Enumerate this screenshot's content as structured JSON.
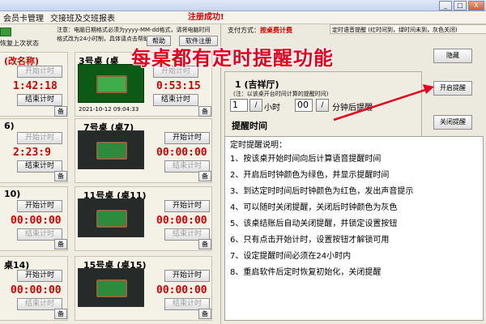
{
  "menu": {
    "items": [
      "会员卡管理",
      "交接班及交班报表"
    ],
    "register_status": "注册成功!"
  },
  "window": {
    "buttons": [
      "_",
      "□",
      "X"
    ]
  },
  "toolbar": {
    "restore_label": "恢复上次状态",
    "notice_line1": "注意：电脑日期格式必须为yyyy-MM-dd格式，请将电脑时间",
    "notice_line2": "格式改为24小时制，具体请点击帮助",
    "help_label": "帮助",
    "soft_reg_label": "软件注册"
  },
  "headline": "每桌都有定时提醒功能",
  "tables": [
    {
      "name": "(改名称)",
      "start": "开始计时",
      "time": "1:42:18",
      "end": "结束计时",
      "date": "",
      "bei": "备"
    },
    {
      "name": "3号桌 (桌",
      "start": "开始计时",
      "time": "0:53:15",
      "end": "结束计时",
      "date": "2021-10-12 09:04:33",
      "bei": "备"
    },
    {
      "name": "6)",
      "start": "开始计时",
      "time": "2:23:9",
      "end": "结束计时",
      "date": "",
      "bei": "备"
    },
    {
      "name": "7号桌 (桌7)",
      "start": "开始计时",
      "time": "00:00:00",
      "end": "结束计时",
      "date": "",
      "bei": "备"
    },
    {
      "name": "10)",
      "start": "开始计时",
      "time": "00:00:00",
      "end": "结束计时",
      "date": "",
      "bei": "备"
    },
    {
      "name": "11号桌 (桌11)",
      "start": "开始计时",
      "time": "00:00:00",
      "end": "结束计时",
      "date": "",
      "bei": "备"
    },
    {
      "name": "桌14)",
      "start": "开始计时",
      "time": "00:00:00",
      "end": "结束计时",
      "date": "",
      "bei": "备"
    },
    {
      "name": "15号桌 (桌15)",
      "start": "开始计时",
      "time": "00:00:00",
      "end": "结束计时",
      "date": "",
      "bei": "备"
    }
  ],
  "right": {
    "pay_prefix": "支付方式：",
    "pay_value": "按桌费计费",
    "tab_text": "定时语音提醒 (红时间到，绿时间未到，灰色关闭)",
    "hall": "1      (吉祥厅)",
    "note": "(注：以该桌开台时间计算的提醒时间)",
    "hours_value": "1",
    "hours_label": "小时",
    "minutes_value": "00",
    "minutes_label": "分钟后提醒",
    "spin_glyph": "/",
    "remind_time_label": "提醒时间",
    "hide_label": "隐藏",
    "open_label": "开启提醒",
    "close_label": "关闭提醒",
    "desc_title": "定时提醒说明：",
    "desc_lines": [
      "1、按该桌开始时间向后计算语音提醒时间",
      "2、开启后时钟颜色为绿色，并显示提醒时间",
      "3、到达定时时间后时钟颜色为红色，发出声音提示",
      "4、可以随时关闭提醒，关闭后时钟颜色为灰色",
      "5、该桌结账后自动关闭提醒，并锁定设置按钮",
      "6、只有点击开始计时，设置按钮才解锁可用",
      "7、设定提醒时间必须在24小时内",
      "8、重启软件后定时恢复初始化，关闭提醒"
    ]
  },
  "colors": {
    "timer_green": "#0a8a0a",
    "timer_red": "#d40000",
    "headline_red": "#e4001e",
    "arrow_red": "#e4001e"
  }
}
